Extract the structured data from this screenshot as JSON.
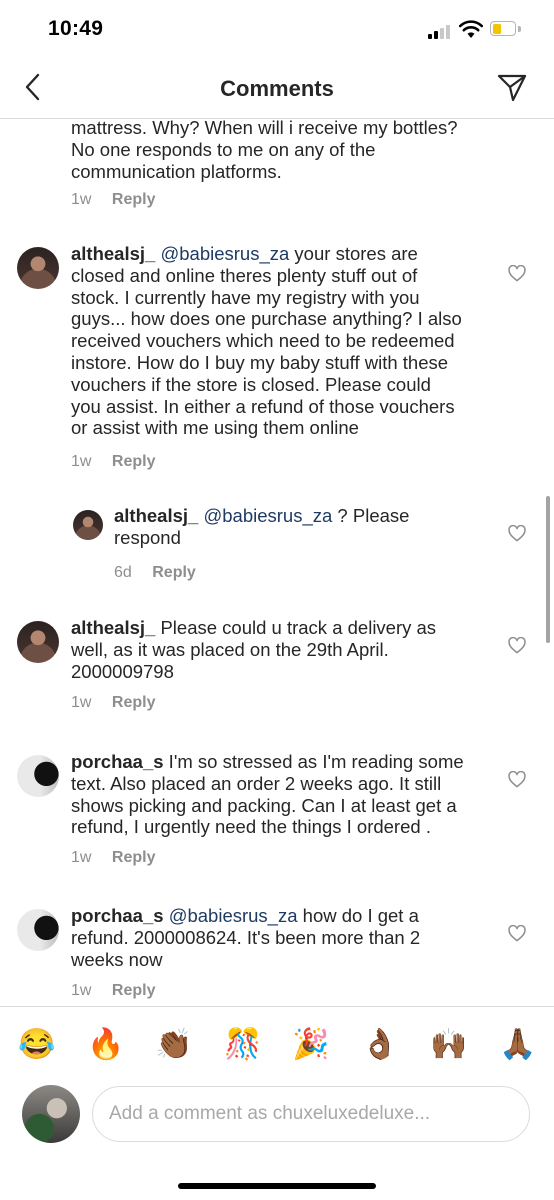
{
  "status": {
    "time": "10:49"
  },
  "header": {
    "title": "Comments"
  },
  "comments": [
    {
      "text_line1": "mattress. Why? When will i receive my bottles?",
      "text_line2": "No one responds to me on any of the",
      "text_line3": "communication platforms.",
      "age": "1w",
      "reply": "Reply"
    },
    {
      "username": "althealsj_",
      "mention": "@babiesrus_za",
      "l1": " your stores are",
      "l2": "closed and online theres plenty stuff out of",
      "l3": "stock. I currently have my registry with you",
      "l4": "guys... how does one purchase anything? I also",
      "l5": "received vouchers which need to be redeemed",
      "l6": "instore. How do I buy my baby stuff with these",
      "l7": "vouchers if the store is closed. Please could",
      "l8": "you assist. In either a refund of those vouchers",
      "l9": "or assist with me using them online",
      "age": "1w",
      "reply": "Reply"
    },
    {
      "username": "althealsj_",
      "mention": "@babiesrus_za",
      "l1": " ? Please",
      "l2": "respond",
      "age": "6d",
      "reply": "Reply"
    },
    {
      "username": "althealsj_",
      "l1": " Please could u track a delivery as",
      "l2": "well, as it was placed on the 29th April.",
      "l3": "2000009798",
      "age": "1w",
      "reply": "Reply"
    },
    {
      "username": "porchaa_s",
      "l1": " I'm so stressed as I'm reading some",
      "l2": "text. Also placed an order 2 weeks ago. It still",
      "l3": "shows picking and packing. Can I at least get a",
      "l4": "refund, I urgently need the things I ordered .",
      "age": "1w",
      "reply": "Reply"
    },
    {
      "username": "porchaa_s",
      "mention": "@babiesrus_za",
      "l1": " how do I get a",
      "l2": "refund. 2000008624. It's been more than 2",
      "l3": "weeks now",
      "age": "1w",
      "reply": "Reply"
    }
  ],
  "emojis": [
    "😂",
    "🔥",
    "👏🏾",
    "🎊",
    "🎉",
    "👌🏾",
    "🙌🏾",
    "🙏🏾"
  ],
  "composer": {
    "placeholder": "Add a comment as chuxeluxedeluxe..."
  }
}
